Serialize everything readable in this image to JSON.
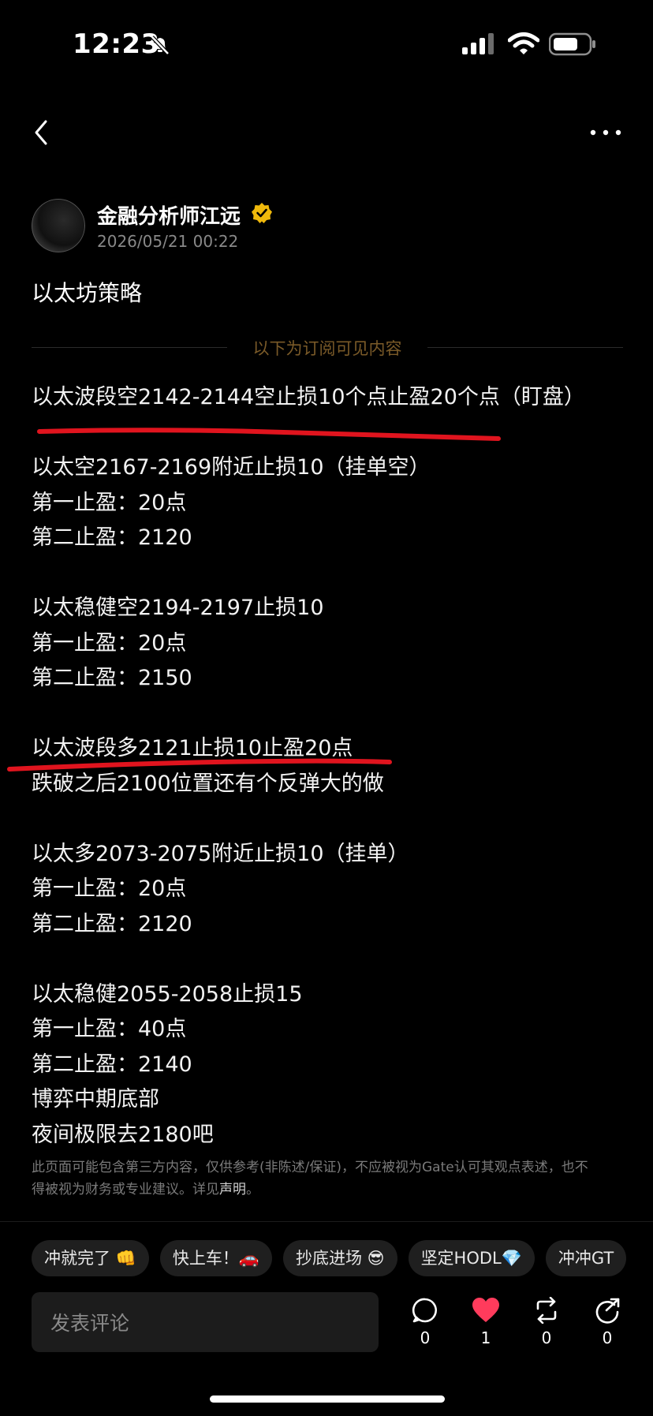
{
  "status_bar": {
    "time": "12:23"
  },
  "author": {
    "name": "金融分析师江远",
    "timestamp": "2026/05/21 00:22"
  },
  "post": {
    "title": "以太坊策略",
    "subscriber_divider": "以下为订阅可见内容",
    "lines": [
      "以太波段空2142-2144空止损10个点止盈20个点（盯盘）",
      "",
      "以太空2167-2169附近止损10（挂单空）",
      "第一止盈：20点",
      "第二止盈：2120",
      "",
      "以太稳健空2194-2197止损10",
      "第一止盈：20点",
      "第二止盈：2150",
      "",
      "以太波段多2121止损10止盈20点",
      "跌破之后2100位置还有个反弹大的做",
      "",
      "以太多2073-2075附近止损10（挂单）",
      "第一止盈：20点",
      "第二止盈：2120",
      "",
      "以太稳健2055-2058止损15",
      "第一止盈：40点",
      "第二止盈：2140",
      "博弈中期底部",
      "夜间极限去2180吧"
    ],
    "disclaimer": "此页面可能包含第三方内容，仅供参考(非陈述/保证)，不应被视为Gate认可其观点表述，也不得被视为财务或专业建议。详见",
    "disclaimer_link": "声明",
    "disclaimer_end": "。"
  },
  "quick_tags": [
    "冲就完了 👊",
    "快上车！🚗",
    "抄底进场 😎",
    "坚定HODL💎",
    "冲冲GT"
  ],
  "comment_placeholder": "发表评论",
  "actions": {
    "comment_count": "0",
    "like_count": "1",
    "repost_count": "0",
    "share_count": "0"
  },
  "colors": {
    "background": "#000000",
    "divider_text": "#7a5a28",
    "verified": "#f0b90b",
    "like": "#ff3b5c",
    "annotation": "#e0141e"
  },
  "icons": [
    "bell-slash-icon",
    "signal-icon",
    "wifi-icon",
    "battery-icon",
    "back-arrow-icon",
    "more-icon",
    "verified-badge-icon",
    "comment-icon",
    "heart-icon",
    "repost-icon",
    "share-icon"
  ]
}
